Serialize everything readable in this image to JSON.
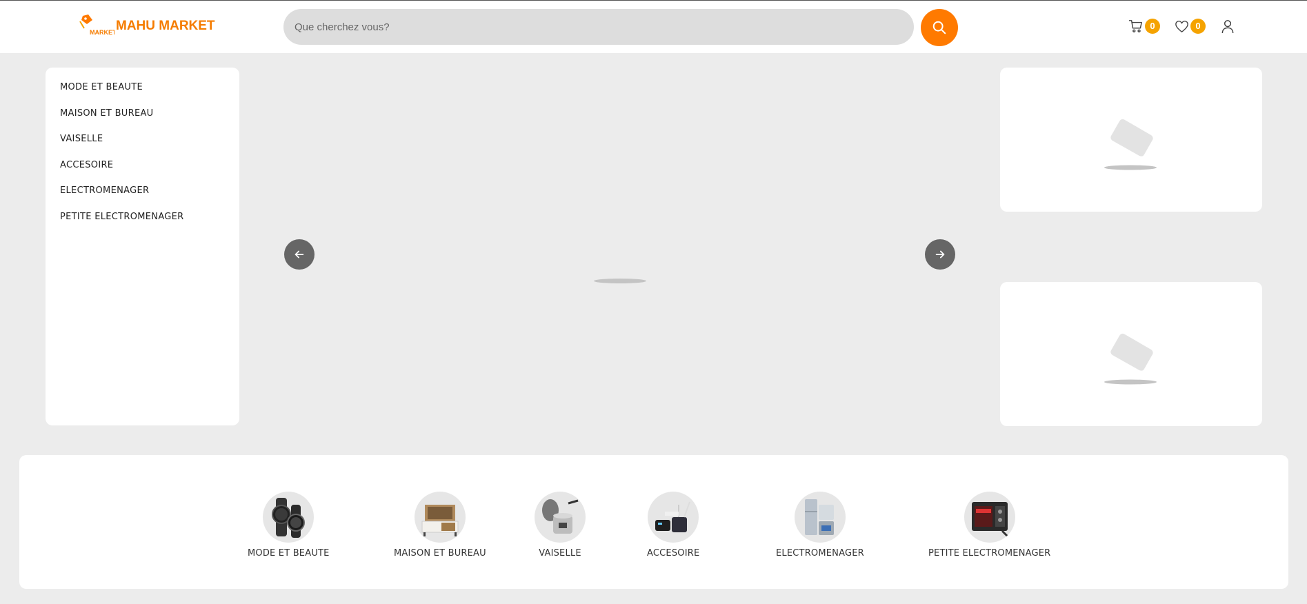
{
  "brand": {
    "name": "MAHU MARKET",
    "mark_text": "MARKET",
    "accent": "#ff7a00"
  },
  "search": {
    "placeholder": "Que cherchez vous?",
    "value": ""
  },
  "header": {
    "cart_count": "0",
    "wishlist_count": "0"
  },
  "categories": [
    {
      "label": "MODE ET BEAUTE",
      "icon": "watch"
    },
    {
      "label": "MAISON ET BUREAU",
      "icon": "furniture"
    },
    {
      "label": "VAISELLE",
      "icon": "cookware"
    },
    {
      "label": "ACCESOIRE",
      "icon": "router"
    },
    {
      "label": "ELECTROMENAGER",
      "icon": "fridge"
    },
    {
      "label": "PETITE ELECTROMENAGER",
      "icon": "oven"
    }
  ]
}
